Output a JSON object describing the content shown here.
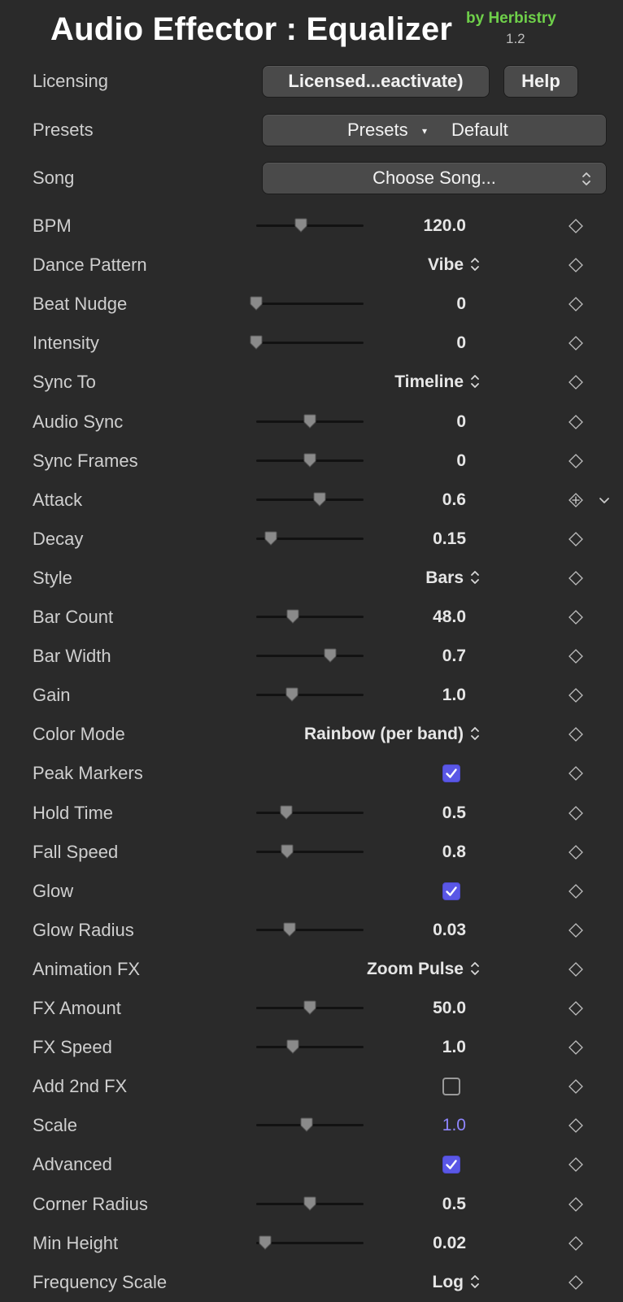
{
  "header": {
    "title": "Audio Effector : Equalizer",
    "byline": "by Herbistry",
    "version": "1.2"
  },
  "licensing": {
    "label": "Licensing",
    "button": "Licensed...eactivate)",
    "help": "Help"
  },
  "presets": {
    "label": "Presets",
    "button_label": "Presets",
    "caret": "▾",
    "value": "Default"
  },
  "song": {
    "label": "Song",
    "button": "Choose Song...",
    "updown": "⌃\n⌄"
  },
  "params": [
    {
      "label": "BPM",
      "kind": "slider",
      "value": "120.0",
      "thumb": 0.42
    },
    {
      "label": "Dance Pattern",
      "kind": "popup",
      "value": "Vibe"
    },
    {
      "label": "Beat Nudge",
      "kind": "slider",
      "value": "0",
      "thumb": 0.0
    },
    {
      "label": "Intensity",
      "kind": "slider",
      "value": "0",
      "thumb": 0.0
    },
    {
      "label": "Sync To",
      "kind": "popup",
      "value": "Timeline"
    },
    {
      "label": "Audio Sync",
      "kind": "slider",
      "value": "0",
      "thumb": 0.5
    },
    {
      "label": "Sync Frames",
      "kind": "slider",
      "value": "0",
      "thumb": 0.5
    },
    {
      "label": "Attack",
      "kind": "slider",
      "value": "0.6",
      "thumb": 0.59,
      "keyframe_active": true,
      "disclosure": true
    },
    {
      "label": "Decay",
      "kind": "slider",
      "value": "0.15",
      "thumb": 0.14
    },
    {
      "label": "Style",
      "kind": "popup",
      "value": "Bars"
    },
    {
      "label": "Bar Count",
      "kind": "slider",
      "value": "48.0",
      "thumb": 0.34
    },
    {
      "label": "Bar Width",
      "kind": "slider",
      "value": "0.7",
      "thumb": 0.69
    },
    {
      "label": "Gain",
      "kind": "slider",
      "value": "1.0",
      "thumb": 0.33
    },
    {
      "label": "Color Mode",
      "kind": "popup",
      "value": "Rainbow (per band)"
    },
    {
      "label": "Peak Markers",
      "kind": "checkbox",
      "checked": true
    },
    {
      "label": "Hold Time",
      "kind": "slider",
      "value": "0.5",
      "thumb": 0.28
    },
    {
      "label": "Fall Speed",
      "kind": "slider",
      "value": "0.8",
      "thumb": 0.29
    },
    {
      "label": "Glow",
      "kind": "checkbox",
      "checked": true
    },
    {
      "label": "Glow Radius",
      "kind": "slider",
      "value": "0.03",
      "thumb": 0.31
    },
    {
      "label": "Animation FX",
      "kind": "popup",
      "value": "Zoom Pulse"
    },
    {
      "label": "FX Amount",
      "kind": "slider",
      "value": "50.0",
      "thumb": 0.5
    },
    {
      "label": "FX Speed",
      "kind": "slider",
      "value": "1.0",
      "thumb": 0.34
    },
    {
      "label": "Add 2nd FX",
      "kind": "checkbox",
      "checked": false
    },
    {
      "label": "Scale",
      "kind": "slider",
      "value": "1.0",
      "thumb": 0.47,
      "highlight": true
    },
    {
      "label": "Advanced",
      "kind": "checkbox",
      "checked": true
    },
    {
      "label": "Corner Radius",
      "kind": "slider",
      "value": "0.5",
      "thumb": 0.5
    },
    {
      "label": "Min Height",
      "kind": "slider",
      "value": "0.02",
      "thumb": 0.08
    },
    {
      "label": "Frequency Scale",
      "kind": "popup",
      "value": "Log"
    }
  ],
  "colors": {
    "background": "#2a2a2a",
    "byline": "#6fd04a",
    "checkbox": "#5a57e6",
    "highlight_value": "#8f86ff"
  }
}
